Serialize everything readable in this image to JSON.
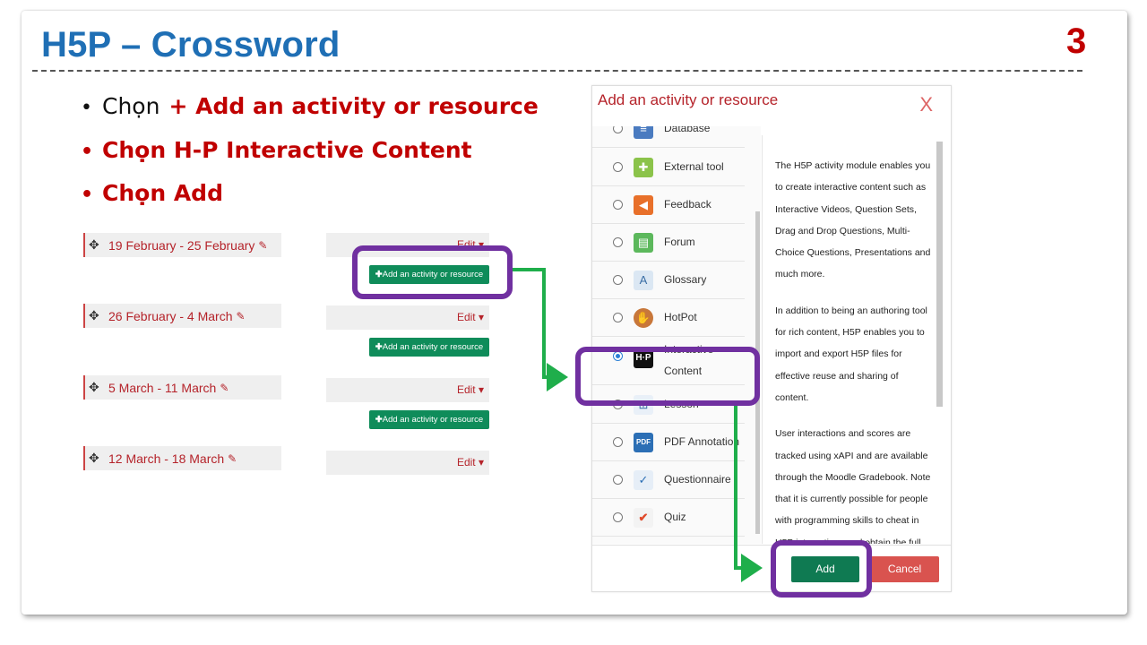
{
  "slide": {
    "title": "H5P – Crossword",
    "page_number": "3"
  },
  "bullets": {
    "b1_prefix": "Chọn",
    "b1_highlight": "+ Add an activity or resource",
    "b2": "Chọn H-P Interactive Content",
    "b3": "Chọn Add"
  },
  "course": {
    "sections": [
      {
        "label": "19 February - 25 February",
        "edit": "Edit"
      },
      {
        "label": "26 February - 4 March",
        "edit": "Edit"
      },
      {
        "label": "5 March - 11 March",
        "edit": "Edit"
      },
      {
        "label": "12 March - 18 March",
        "edit": "Edit"
      }
    ],
    "add_label": "Add an activity or resource"
  },
  "dialog": {
    "title": "Add an activity or resource",
    "close": "X",
    "options": [
      "Database",
      "External tool",
      "Feedback",
      "Forum",
      "Glossary",
      "HotPot",
      "Interactive",
      "Content",
      "Lesson",
      "PDF Annotation",
      "Questionnaire",
      "Quiz"
    ],
    "description": {
      "p1": "The H5P activity module enables you to create interactive content such as Interactive Videos, Question Sets, Drag and Drop Questions, Multi-Choice Questions, Presentations and much more.",
      "p2": "In addition to being an authoring tool for rich content, H5P enables you to import and export H5P files for effective reuse and sharing of content.",
      "p3": "User interactions and scores are tracked using xAPI and are available through the Moodle Gradebook. Note that it is currently possible for people with programming skills to cheat in H5P interactions and obtain the full score without knowing the correct answers."
    },
    "add_button": "Add",
    "cancel_button": "Cancel"
  },
  "colors": {
    "title_blue": "#1f6fb5",
    "accent_red": "#c00000",
    "highlight_purple": "#7030a0",
    "arrow_green": "#1fae4b",
    "button_green": "#0f8c5a"
  }
}
